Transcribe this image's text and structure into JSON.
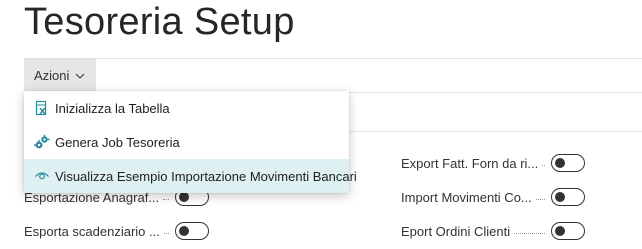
{
  "page": {
    "title": "Tesoreria Setup"
  },
  "action_bar": {
    "azioni_label": "Azioni"
  },
  "menu": {
    "items": [
      {
        "label": "Inizializza la Tabella",
        "icon": "clear-table-icon"
      },
      {
        "label": "Genera Job Tesoreria",
        "icon": "gears-icon"
      },
      {
        "label": "Visualizza Esempio Importazione Movimenti Bancari",
        "icon": "view-eye-icon"
      }
    ]
  },
  "fields": {
    "left": [
      {
        "label": "Esportazione Anagraf...",
        "value": false
      },
      {
        "label": "Esporta scadenziario ...",
        "value": false
      }
    ],
    "right": [
      {
        "label": "Export Fatt. Forn da ri...",
        "value": false
      },
      {
        "label": "Import Movimenti Co...",
        "value": false
      },
      {
        "label": "Eport Ordini Clienti",
        "value": false
      }
    ]
  },
  "colors": {
    "accent": "#00a3b8",
    "menu_hover": "#dff0f2",
    "azioni_bg": "#e6e6e6"
  }
}
